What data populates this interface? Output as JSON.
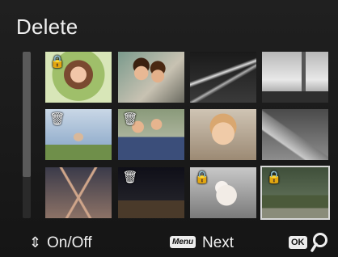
{
  "screen": {
    "title": "Delete"
  },
  "thumbnails": [
    {
      "name": "woman-portrait",
      "badge": "lock",
      "badge_char": "🔒"
    },
    {
      "name": "couple-portrait",
      "badge": "",
      "badge_char": ""
    },
    {
      "name": "night-highway",
      "badge": "",
      "badge_char": ""
    },
    {
      "name": "london-skyline",
      "badge": "",
      "badge_char": ""
    },
    {
      "name": "woman-arms-outstretched",
      "badge": "trash",
      "badge_char": "🗑"
    },
    {
      "name": "family-group",
      "badge": "trash",
      "badge_char": "🗑"
    },
    {
      "name": "baby",
      "badge": "",
      "badge_char": ""
    },
    {
      "name": "leaf-closeup",
      "badge": "",
      "badge_char": ""
    },
    {
      "name": "ferris-wheel",
      "badge": "",
      "badge_char": ""
    },
    {
      "name": "city-night",
      "badge": "trash",
      "badge_char": "🗑"
    },
    {
      "name": "teddy-bear",
      "badge": "lock",
      "badge_char": "🔒"
    },
    {
      "name": "beach-landscape",
      "badge": "lock",
      "badge_char": "🔒",
      "selected": true
    }
  ],
  "footer": {
    "updown_icon": "up-down-arrows-icon",
    "updown_char": "⇕",
    "onoff_label": "On/Off",
    "menu_key_label": "Menu",
    "next_label": "Next",
    "ok_key_label": "OK",
    "magnify_icon": "magnify-icon"
  }
}
